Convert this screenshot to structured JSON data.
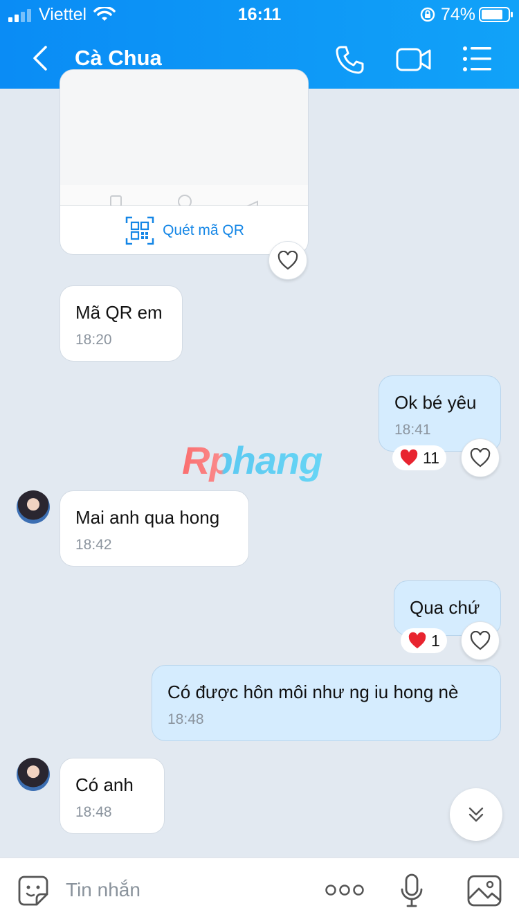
{
  "status_bar": {
    "carrier": "Viettel",
    "time": "16:11",
    "battery": "74%"
  },
  "header": {
    "title": "Cà Chua",
    "icons": [
      "back-icon",
      "phone-icon",
      "video-icon",
      "menu-icon"
    ]
  },
  "qr_card": {
    "action_label": "Quét mã QR"
  },
  "messages": [
    {
      "side": "them",
      "text": "Mã QR em",
      "time": "18:20"
    },
    {
      "side": "me",
      "text": "Ok bé yêu",
      "time": "18:41",
      "reaction_count": "11"
    },
    {
      "side": "them",
      "text": "Mai anh qua hong",
      "time": "18:42"
    },
    {
      "side": "me",
      "text": "Qua chứ",
      "reaction_count": "1"
    },
    {
      "side": "me",
      "text": "Có được hôn môi như ng iu hong nè",
      "time": "18:48"
    },
    {
      "side": "them",
      "text": "Có anh",
      "time": "18:48"
    }
  ],
  "watermark": "Rphang",
  "input": {
    "placeholder": "Tin nhắn"
  },
  "colors": {
    "header": "#0a8cf5",
    "my_bubble": "#d5ecfe",
    "background": "#e2e9f1",
    "reaction_heart": "#e8242f"
  }
}
